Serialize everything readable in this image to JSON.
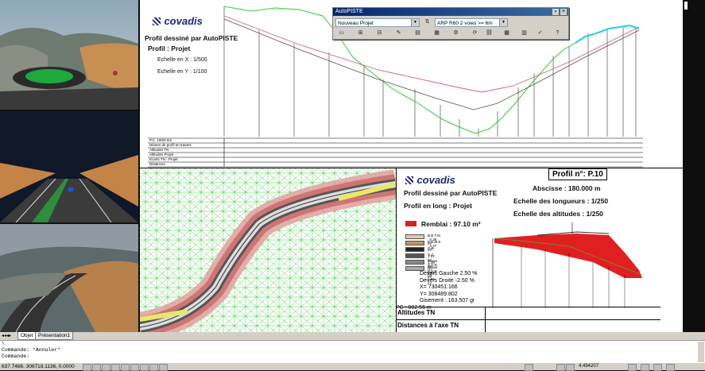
{
  "toolbar": {
    "title": "AutoPISTE",
    "close": "×",
    "pin": "▪",
    "project_combo": "Nouveau Projet",
    "template_combo": "ARP R60 2 voies >= 6m"
  },
  "upper_sheet": {
    "logo": "covadis",
    "title": "Profil dessiné par AutoPISTE",
    "subtitle": "Profil :  Projet",
    "scale_x": "Echelle en X : 1/500",
    "scale_y": "Echelle en Y : 1/100",
    "table_rows": [
      "P.C. 100/0.0m",
      "Dévers de profil en travers",
      "Altitudes TN",
      "Altitudes Projet",
      "Ecarts TN - Projet",
      "Distances"
    ]
  },
  "lower_sheet": {
    "logo": "covadis",
    "title": "Profil dessiné par AutoPISTE",
    "subtitle": "Profil en long : Projet",
    "profile_label": "Profil n°: P.10",
    "abscisse": "Abscisse : 180.000 m",
    "echelle_longueurs": "Echelle des longueurs : 1/250",
    "echelle_altitudes": "Echelle des altitudes : 1/250",
    "remblai": "Remblai : 97.10 m²",
    "legend": [
      {
        "label": "B.B.T.M : 0.36 m²",
        "color": "#e8c8b0"
      },
      {
        "label": "B.B.M.E : 0.47 m²",
        "color": "#c89060"
      },
      {
        "label": "G.B. : 1.01 m²",
        "color": "#222222"
      },
      {
        "label": "G.C. : 1.39 m²",
        "color": "#555555"
      },
      {
        "label": "Grave S.A.R. (1) : 0.94 m²",
        "color": "#888888"
      },
      {
        "label": "Grave S.A.R. (2) : 1.96 m²",
        "color": "#aaaaaa"
      }
    ],
    "devers_gauche": "Dévers Gauche 2.50 %",
    "devers_droite": "Dévers Droite -2.50 %",
    "x_coord": "X= 730451.166",
    "y_coord": "Y= 308489.802",
    "gisement": "Gisement : 163.507 gr",
    "pc": "PC : 802.56 m",
    "row_altitudes": "Altitudes TN",
    "row_distances": "Distances à l'axe TN"
  },
  "tabs": [
    "Objet",
    "Présentation1"
  ],
  "command_lines": [
    "\\",
    "Commande: *Annuler*",
    "Commande:"
  ],
  "status": {
    "coords": "637.7466, 306719.1136, 0.0000",
    "zoom": "4.494207"
  },
  "colors": {
    "terrain_line": "#33cc33",
    "project_line": "#cc6677",
    "fill_remblai": "#e02020",
    "logo_blue": "#1b2a78",
    "cyan_segment": "#22d0e8"
  }
}
